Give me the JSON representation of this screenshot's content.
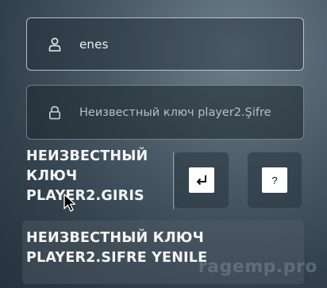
{
  "username": {
    "value": "enes",
    "icon": "user-icon"
  },
  "password": {
    "placeholder": "Неизвестный ключ player2.Şifre",
    "icon": "lock-icon"
  },
  "login_button": {
    "label": "НЕИЗВЕСТНЫЙ КЛЮЧ PLAYER2.GIRIS"
  },
  "enter_button": {
    "icon": "enter-key-icon"
  },
  "help_button": {
    "label": "?"
  },
  "reset_button": {
    "label": "НЕИЗВЕСТНЫЙ КЛЮЧ PLAYER2.SIFRE YENILE"
  },
  "watermark": {
    "text": "ragemp.pro"
  }
}
